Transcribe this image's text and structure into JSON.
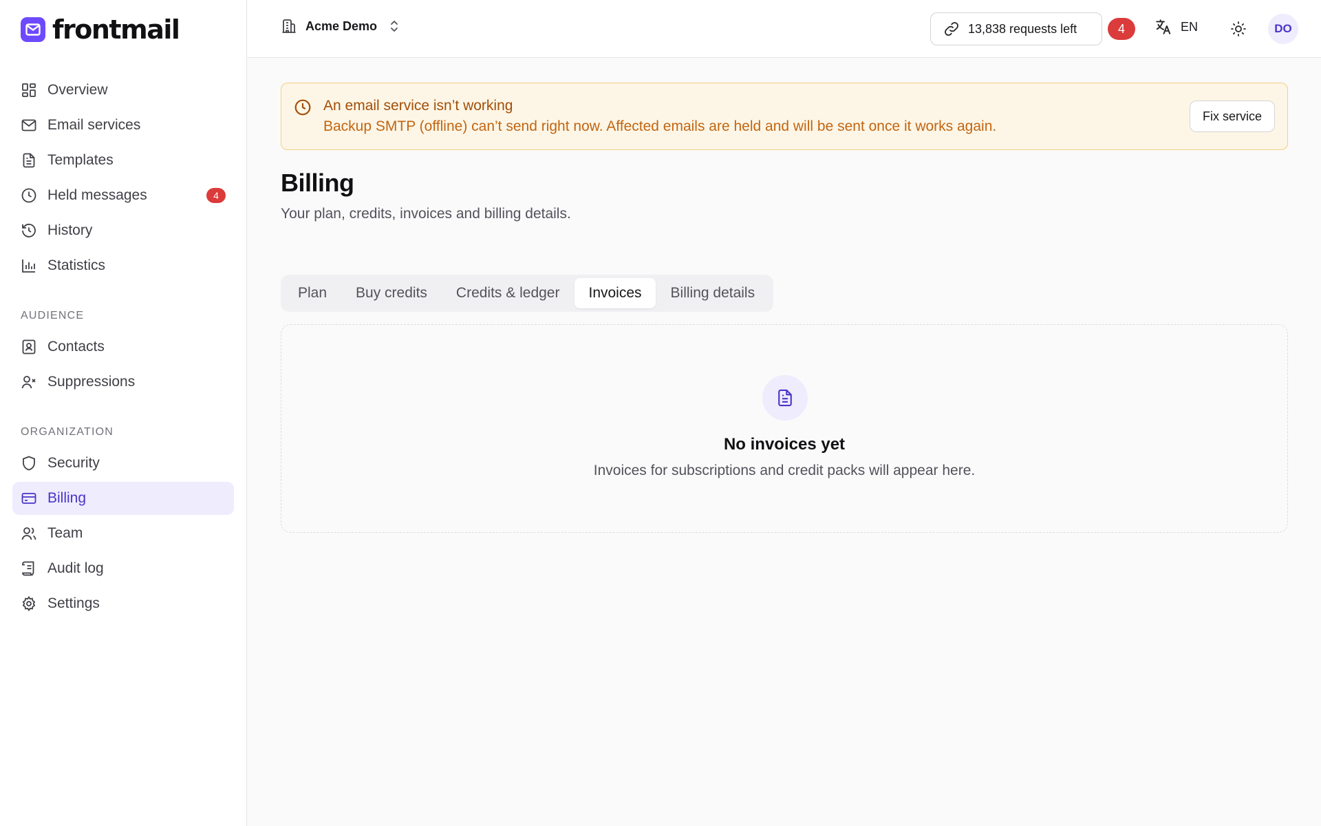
{
  "app": {
    "name": "frontmail"
  },
  "sidebar": {
    "nav": [
      {
        "label": "Overview",
        "icon": "overview-icon"
      },
      {
        "label": "Email services",
        "icon": "mail-icon"
      },
      {
        "label": "Templates",
        "icon": "document-icon"
      },
      {
        "label": "Held messages",
        "icon": "clock-icon",
        "badge": "4"
      },
      {
        "label": "History",
        "icon": "history-icon"
      },
      {
        "label": "Statistics",
        "icon": "bar-chart-icon"
      }
    ],
    "audience": {
      "heading": "AUDIENCE",
      "items": [
        {
          "label": "Contacts",
          "icon": "contact-icon"
        },
        {
          "label": "Suppressions",
          "icon": "user-x-icon"
        }
      ]
    },
    "organization": {
      "heading": "ORGANIZATION",
      "items": [
        {
          "label": "Security",
          "icon": "shield-icon"
        },
        {
          "label": "Billing",
          "icon": "credit-card-icon",
          "active": true
        },
        {
          "label": "Team",
          "icon": "users-icon"
        },
        {
          "label": "Audit log",
          "icon": "scroll-icon"
        },
        {
          "label": "Settings",
          "icon": "gear-icon"
        }
      ]
    }
  },
  "topbar": {
    "org_name": "Acme Demo",
    "requests": "13,838 requests left",
    "notification_count": "4",
    "language": "EN",
    "avatar_initials": "DO"
  },
  "alert": {
    "title": "An email service isn’t working",
    "body": "Backup SMTP (offline) can’t send right now. Affected emails are held and will be sent once it works again.",
    "action": "Fix service"
  },
  "page": {
    "title": "Billing",
    "subtitle": "Your plan, credits, invoices and billing details."
  },
  "tabs": [
    {
      "label": "Plan"
    },
    {
      "label": "Buy credits"
    },
    {
      "label": "Credits & ledger"
    },
    {
      "label": "Invoices",
      "active": true
    },
    {
      "label": "Billing details"
    }
  ],
  "empty_state": {
    "title": "No invoices yet",
    "subtitle": "Invoices for subscriptions and credit packs will appear here."
  },
  "colors": {
    "brand": "#6d4aff",
    "active_bg": "#eeecfd",
    "active_text": "#4a34c8",
    "badge": "#dc3b3b",
    "alert_bg": "#fdf6e6",
    "alert_border": "#f3cf84",
    "alert_text": "#a24e08"
  }
}
